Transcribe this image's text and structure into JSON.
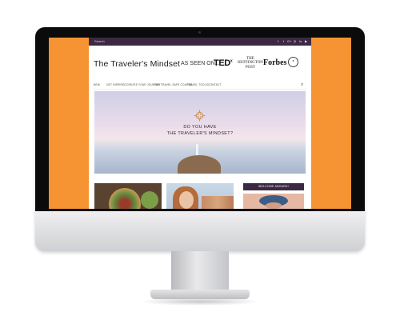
{
  "colors": {
    "screen_background": "#f69332",
    "accent_purple": "#3b2944",
    "hero_sky": "#e8dbea"
  },
  "topbar": {
    "search_label": "Search",
    "social_icons": [
      "facebook-icon",
      "twitter-icon",
      "google-plus-icon",
      "instagram-icon",
      "linkedin-icon",
      "youtube-icon"
    ],
    "social_glyphs": [
      "f",
      "t",
      "G+",
      "◎",
      "in",
      "▶"
    ]
  },
  "header": {
    "brand": "The Traveler's Mindset",
    "as_seen_on": "AS SEEN ON...",
    "press_ted": "TED",
    "press_ted_x": "x",
    "press_huffington": "THE HUFFINGTON POST",
    "press_forbes": "Forbes",
    "press_seal": "★"
  },
  "nav": {
    "items": [
      {
        "label": "NEW"
      },
      {
        "label": "GET INSPIRED"
      },
      {
        "label": "CREATE YOUR JOURNEY"
      },
      {
        "label": "THE TRAVEL SAFE COURSE"
      },
      {
        "label": "TRAVEL TOOLS"
      },
      {
        "label": "CONTACT"
      }
    ],
    "search_icon": "⌕"
  },
  "hero": {
    "line1": "DO YOU HAVE",
    "line2": "THE TRAVELER'S MINDSET?"
  },
  "sidebar": {
    "welcome_label": "WELCOME ABOARD!"
  }
}
